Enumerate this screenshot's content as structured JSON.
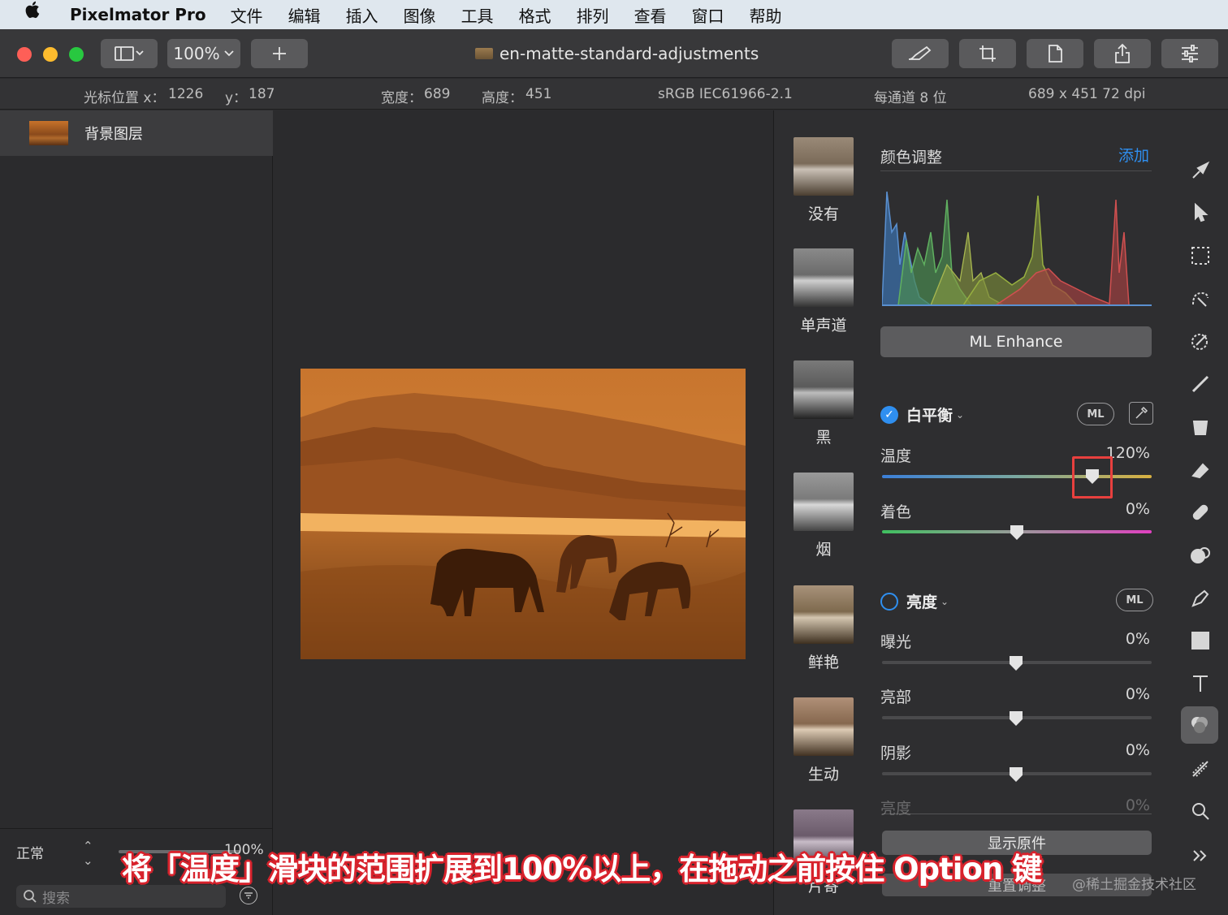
{
  "menubar": {
    "apple_icon": "apple-logo",
    "app_name": "Pixelmator Pro",
    "items": [
      "文件",
      "编辑",
      "插入",
      "图像",
      "工具",
      "格式",
      "排列",
      "查看",
      "窗口",
      "帮助"
    ]
  },
  "toolbar": {
    "zoom": "100%",
    "document_title": "en-matte-standard-adjustments"
  },
  "infobar": {
    "cursor_x_label": "光标位置 x：",
    "cursor_x": "1226",
    "cursor_y_label": "y：",
    "cursor_y": "187",
    "width_label": "宽度：",
    "width": "689",
    "height_label": "高度：",
    "height": "451",
    "color_profile": "sRGB IEC61966-2.1",
    "bit_depth": "每通道 8 位",
    "dimensions": "689 x 451 72 dpi"
  },
  "layers": {
    "items": [
      {
        "name": "背景图层"
      }
    ],
    "blend_mode": "正常",
    "opacity": "100%",
    "search_placeholder": "搜索"
  },
  "presets": [
    {
      "label": "没有"
    },
    {
      "label": "单声道"
    },
    {
      "label": "黑"
    },
    {
      "label": "烟"
    },
    {
      "label": "鲜艳"
    },
    {
      "label": "生动"
    },
    {
      "label": "片寄"
    }
  ],
  "adjustments": {
    "title": "颜色调整",
    "add_label": "添加",
    "ml_enhance": "ML Enhance",
    "white_balance": {
      "title": "白平衡",
      "enabled": true,
      "ml_label": "ML",
      "temperature_label": "温度",
      "temperature_value": "120%",
      "temperature_level": 0.78,
      "tint_label": "着色",
      "tint_value": "0%",
      "tint_level": 0.5
    },
    "brightness": {
      "title": "亮度",
      "enabled": false,
      "ml_label": "ML",
      "exposure_label": "曝光",
      "exposure_value": "0%",
      "highlights_label": "亮部",
      "highlights_value": "0%",
      "shadows_label": "阴影",
      "shadows_value": "0%",
      "brightness_label": "亮度",
      "brightness_value": "0%"
    },
    "show_original": "显示原件",
    "reset": "重置调整"
  },
  "tools": [
    "style-tool-icon",
    "arrange-tool-icon",
    "selection-tool-icon",
    "smart-selection-icon",
    "color-picker-icon",
    "paint-brush-icon",
    "paint-bucket-icon",
    "eraser-icon",
    "repair-tool-icon",
    "clone-tool-icon",
    "pen-tool-icon",
    "shape-tool-icon",
    "type-tool-icon",
    "color-adjust-icon",
    "effects-icon",
    "zoom-tool-icon",
    "more-tools-icon"
  ],
  "caption": "将「温度」滑块的范围扩展到100%以上，在拖动之前按住 Option 键",
  "watermark": "@稀土掘金技术社区",
  "colors": {
    "accent": "#2f8ff0",
    "highlight": "#e8403e",
    "caption_outline": "#d8222c"
  }
}
